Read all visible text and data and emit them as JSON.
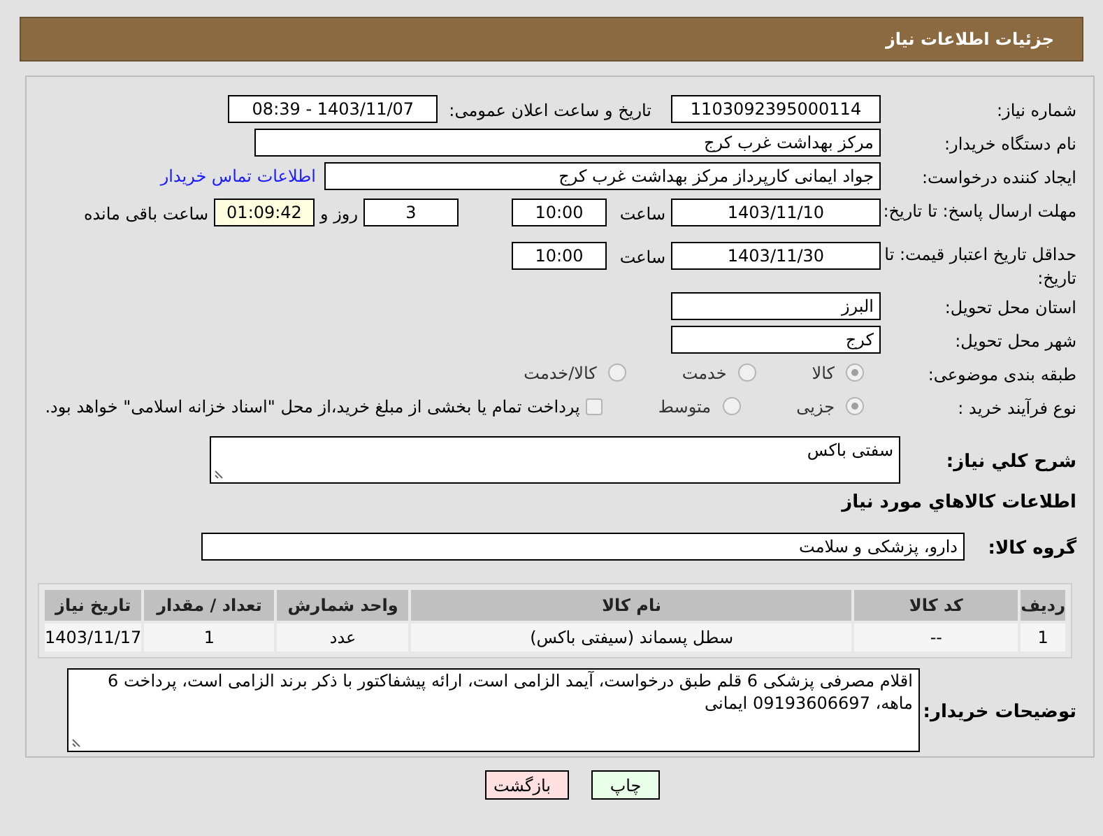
{
  "header": {
    "title": "جزئیات اطلاعات نیاز"
  },
  "need_number": {
    "label": "شماره نیاز:",
    "value": "1103092395000114"
  },
  "announce": {
    "label": "تاریخ و ساعت اعلان عمومی:",
    "value": "1403/11/07 - 08:39"
  },
  "buyer_org": {
    "label": "نام دستگاه خریدار:",
    "value": "مرکز بهداشت غرب کرج"
  },
  "creator": {
    "label": "ایجاد کننده درخواست:",
    "value": "جواد ایمانی کارپرداز مرکز بهداشت غرب کرج",
    "link": "اطلاعات تماس خریدار"
  },
  "reply_deadline": {
    "label": "مهلت ارسال پاسخ: تا تاریخ:",
    "date": "1403/11/10",
    "time_label": "ساعت",
    "time": "10:00",
    "days": "3",
    "days_label": "روز و",
    "remaining": "01:09:42",
    "remaining_label": "ساعت باقی مانده"
  },
  "price_validity": {
    "label": "حداقل تاریخ اعتبار قیمت: تا تاریخ:",
    "date": "1403/11/30",
    "time_label": "ساعت",
    "time": "10:00"
  },
  "province": {
    "label": "استان محل تحویل:",
    "value": "البرز"
  },
  "city": {
    "label": "شهر محل تحویل:",
    "value": "کرج"
  },
  "category": {
    "label": "طبقه بندی موضوعی:",
    "options": [
      {
        "label": "کالا",
        "selected": true,
        "disabled": true
      },
      {
        "label": "خدمت",
        "selected": false,
        "disabled": true
      },
      {
        "label": "کالا/خدمت",
        "selected": false,
        "disabled": true
      }
    ]
  },
  "process": {
    "label": "نوع فرآیند خرید :",
    "options": [
      {
        "label": "جزیی",
        "selected": true,
        "disabled": true
      },
      {
        "label": "متوسط",
        "selected": false,
        "disabled": true
      }
    ],
    "treasury": {
      "checked": false,
      "disabled": true,
      "label": "پرداخت تمام یا بخشی از مبلغ خرید،از محل \"اسناد خزانه اسلامی\" خواهد بود."
    }
  },
  "description": {
    "label": "شرح کلي نیاز:",
    "value": "سفتی باکس"
  },
  "goods_heading": "اطلاعات کالاهاي مورد نیاز",
  "goods_group": {
    "label": "گروه کالا:",
    "value": "دارو، پزشکی و سلامت"
  },
  "table": {
    "columns": [
      "ردیف",
      "کد کالا",
      "نام کالا",
      "واحد شمارش",
      "تعداد / مقدار",
      "تاریخ نیاز"
    ],
    "rows": [
      [
        "1",
        "--",
        "سطل پسماند (سیفتی باکس)",
        "عدد",
        "1",
        "1403/11/17"
      ]
    ]
  },
  "buyer_notes": {
    "label": "توضیحات خریدار:",
    "value": "اقلام مصرفی پزشکی 6 قلم طبق درخواست، آیمد الزامی است، ارائه پیشفاکتور با ذکر برند الزامی است، پرداخت 6 ماهه، 09193606697 ایمانی"
  },
  "buttons": [
    {
      "label": "چاپ",
      "kind": "print"
    },
    {
      "label": "بازگشت",
      "kind": "back"
    }
  ]
}
